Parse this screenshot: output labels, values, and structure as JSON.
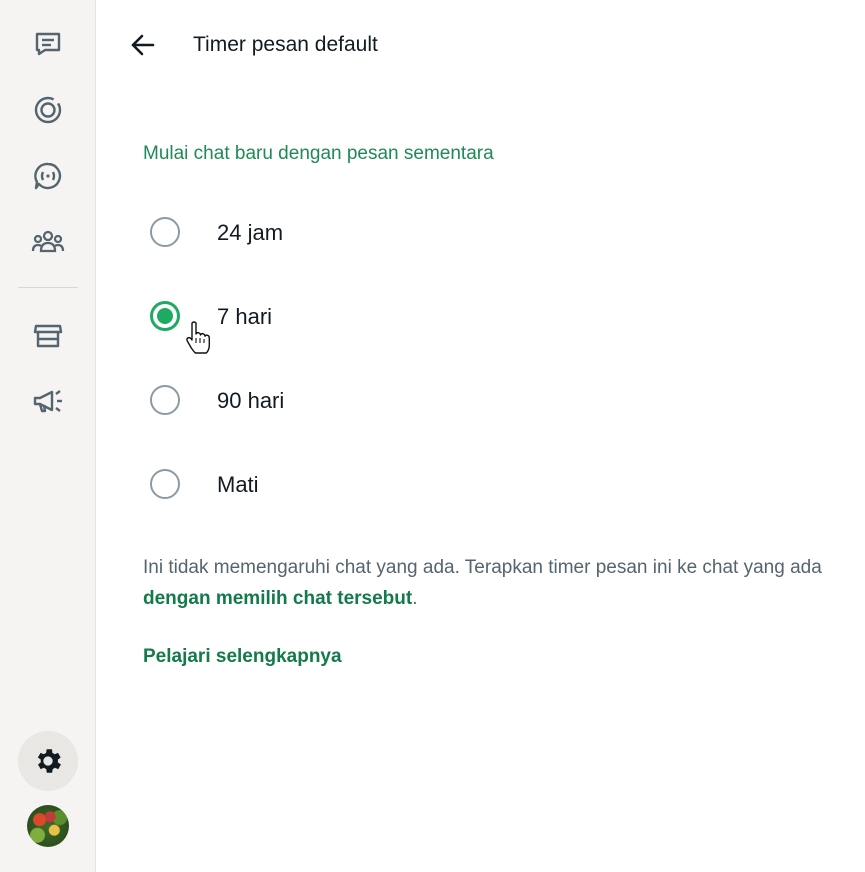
{
  "header": {
    "title": "Timer pesan default"
  },
  "section": {
    "title": "Mulai chat baru dengan pesan sementara"
  },
  "options": [
    {
      "label": "24 jam",
      "selected": false
    },
    {
      "label": "7 hari",
      "selected": true
    },
    {
      "label": "90 hari",
      "selected": false
    },
    {
      "label": "Mati",
      "selected": false
    }
  ],
  "info": {
    "text_before": "Ini tidak memengaruhi chat yang ada. Terapkan timer pesan ini ke chat yang ada ",
    "link": "dengan memilih chat tersebut",
    "text_after": "."
  },
  "learn_more": "Pelajari selengkapnya",
  "sidebar": {
    "icons": [
      "chats-icon",
      "status-icon",
      "channels-icon",
      "communities-icon",
      "store-icon",
      "megaphone-icon",
      "gear-icon"
    ]
  },
  "colors": {
    "accent": "#1daa61",
    "link": "#137a4a"
  }
}
